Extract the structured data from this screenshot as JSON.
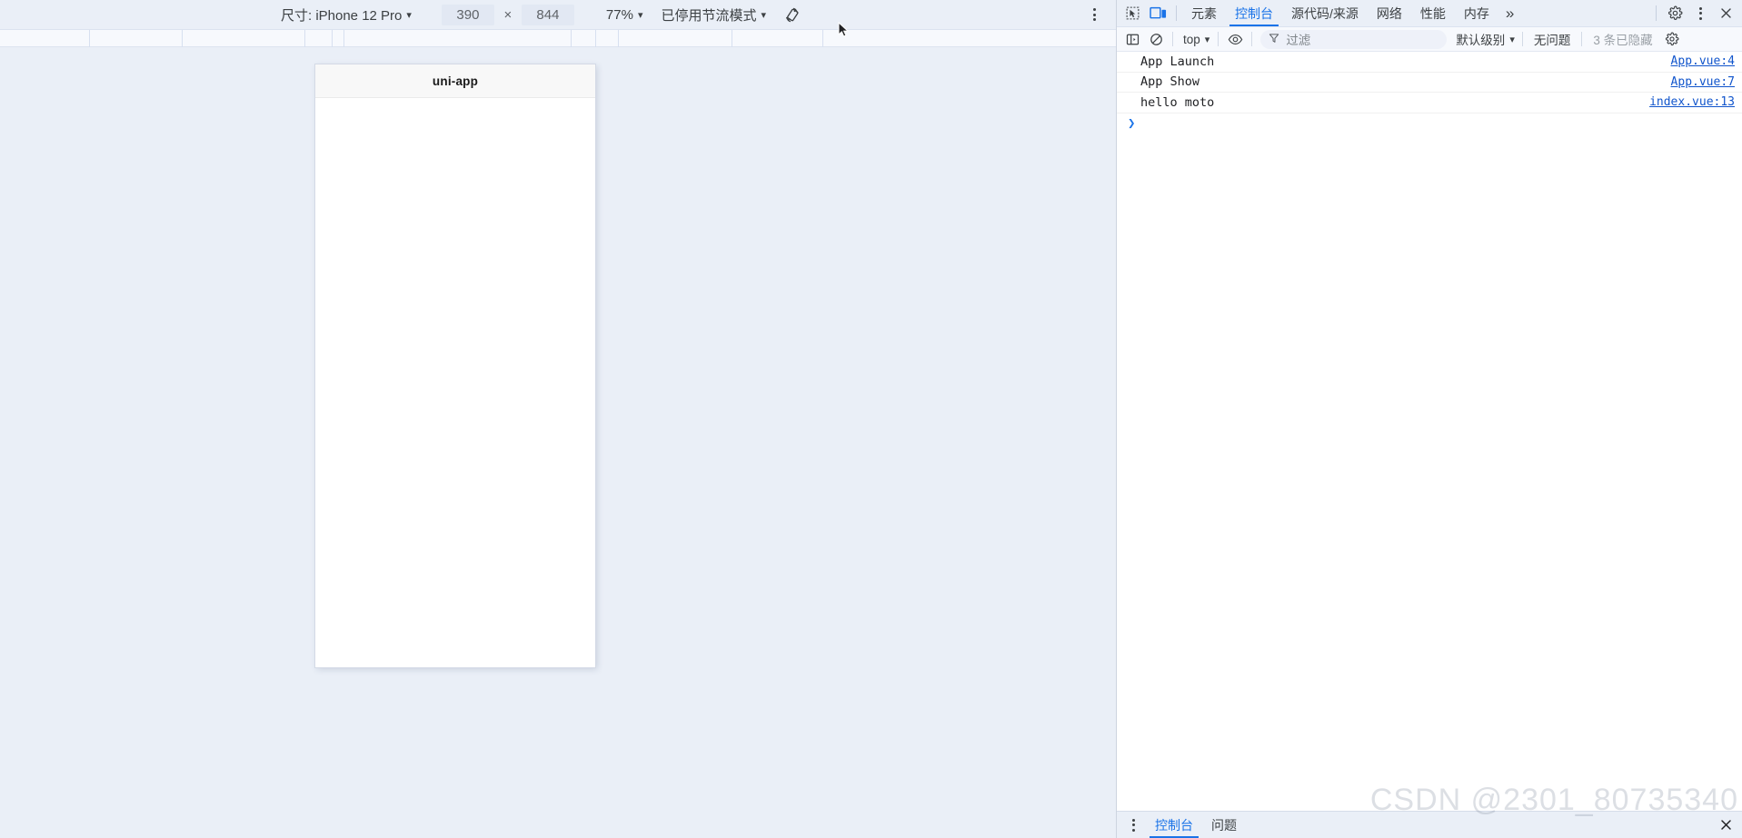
{
  "device_toolbar": {
    "size_label": "尺寸: iPhone 12 Pro",
    "width": "390",
    "times": "×",
    "height": "844",
    "zoom": "77%",
    "throttling": "已停用节流模式",
    "rotate_icon": "rotate-device-icon",
    "more_icon": "more-options-icon",
    "caret": "▾"
  },
  "device_preview": {
    "app_title": "uni-app"
  },
  "devtools": {
    "toolbar_icons": {
      "inspect": "inspect-element-icon",
      "device_toggle": "device-toolbar-icon",
      "settings": "gear-icon",
      "more": "more-options-icon",
      "close": "close-icon"
    },
    "tabs": [
      {
        "label": "元素",
        "active": false
      },
      {
        "label": "控制台",
        "active": true
      },
      {
        "label": "源代码/来源",
        "active": false
      },
      {
        "label": "网络",
        "active": false
      },
      {
        "label": "性能",
        "active": false
      },
      {
        "label": "内存",
        "active": false
      }
    ],
    "more_tabs": "»"
  },
  "console_toolbar": {
    "sidebar_icon": "console-sidebar-icon",
    "clear_icon": "clear-console-icon",
    "context": "top",
    "eye_icon": "live-expression-icon",
    "filter_icon": "filter-icon",
    "filter_placeholder": "过滤",
    "level": "默认级别",
    "issues": "无问题",
    "hidden": "3 条已隐藏",
    "settings_icon": "gear-icon",
    "caret": "▾"
  },
  "console_messages": [
    {
      "text": "App Launch",
      "source": "App.vue:4"
    },
    {
      "text": "App Show",
      "source": "App.vue:7"
    },
    {
      "text": "hello moto",
      "source": "index.vue:13"
    }
  ],
  "console_prompt": {
    "arrow": "❯"
  },
  "drawer": {
    "menu_icon": "more-options-icon",
    "tabs": [
      {
        "label": "控制台",
        "active": true
      },
      {
        "label": "问题",
        "active": false
      }
    ],
    "close_icon": "close-icon"
  },
  "watermark": {
    "text": "CSDN @2301_80735340"
  },
  "colors": {
    "accent": "#1a73e8",
    "toolbar_bg": "#eaeff7",
    "link": "#1155cc",
    "stage_bg": "#eaeff7"
  }
}
